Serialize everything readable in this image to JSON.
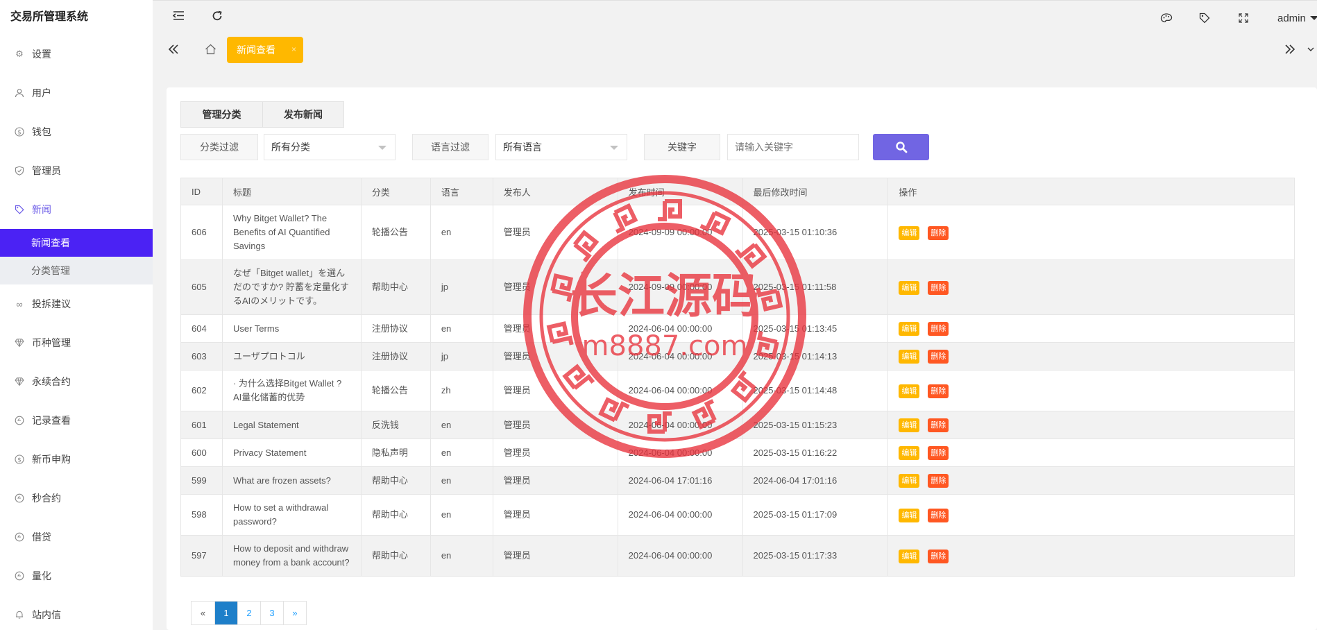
{
  "app": {
    "title": "交易所管理系统"
  },
  "header": {
    "user": "admin"
  },
  "sidebar": {
    "items": [
      {
        "label": "设置",
        "icon": "gear-icon"
      },
      {
        "label": "用户",
        "icon": "user-icon"
      },
      {
        "label": "钱包",
        "icon": "dollar-icon"
      },
      {
        "label": "管理员",
        "icon": "shield-icon"
      },
      {
        "label": "新闻",
        "icon": "tag-icon",
        "active": true
      }
    ],
    "sub_items": [
      {
        "label": "新闻查看",
        "active": true
      },
      {
        "label": "分类管理"
      }
    ],
    "items_after": [
      {
        "label": "投拆建议",
        "icon": "link-icon"
      },
      {
        "label": "币种管理",
        "icon": "diamond-icon"
      },
      {
        "label": "永续合约",
        "icon": "diamond-icon"
      },
      {
        "label": "记录查看",
        "icon": "circle-icon"
      },
      {
        "label": "新币申购",
        "icon": "dollar-icon"
      },
      {
        "label": "秒合约",
        "icon": "circle-icon"
      },
      {
        "label": "借贷",
        "icon": "circle-icon"
      },
      {
        "label": "量化",
        "icon": "circle-icon"
      },
      {
        "label": "站内信",
        "icon": "bell-icon"
      }
    ]
  },
  "tabs": {
    "active_tab": "新闻查看",
    "close_glyph": "×"
  },
  "toolbar": {
    "manage_category": "管理分类",
    "publish_news": "发布新闻"
  },
  "filters": {
    "category_label": "分类过滤",
    "category_value": "所有分类",
    "language_label": "语言过滤",
    "language_value": "所有语言",
    "keyword_label": "关键字",
    "keyword_placeholder": "请输入关键字"
  },
  "table": {
    "columns": [
      "ID",
      "标题",
      "分类",
      "语言",
      "发布人",
      "发布时间",
      "最后修改时间",
      "操作"
    ],
    "edit_label": "编辑",
    "delete_label": "删除",
    "rows": [
      {
        "id": "606",
        "title": "Why Bitget Wallet? The Benefits of AI Quantified Savings",
        "category": "轮播公告",
        "lang": "en",
        "author": "管理员",
        "published": "2024-09-09 00:00:00",
        "modified": "2025-03-15 01:10:36"
      },
      {
        "id": "605",
        "title": "なぜ「Bitget wallet」を選んだのですか? 貯蓄を定量化するAIのメリットです。",
        "category": "帮助中心",
        "lang": "jp",
        "author": "管理员",
        "published": "2024-09-09 00:00:00",
        "modified": "2025-03-15 01:11:58"
      },
      {
        "id": "604",
        "title": "User Terms",
        "category": "注册协议",
        "lang": "en",
        "author": "管理员",
        "published": "2024-06-04 00:00:00",
        "modified": "2025-03-15 01:13:45"
      },
      {
        "id": "603",
        "title": "ユーザプロトコル",
        "category": "注册协议",
        "lang": "jp",
        "author": "管理员",
        "published": "2024-06-04 00:00:00",
        "modified": "2025-03-15 01:14:13"
      },
      {
        "id": "602",
        "title": "· 为什么选择Bitget Wallet ? AI量化储蓄的优势",
        "category": "轮播公告",
        "lang": "zh",
        "author": "管理员",
        "published": "2024-06-04 00:00:00",
        "modified": "2025-03-15 01:14:48"
      },
      {
        "id": "601",
        "title": "Legal Statement",
        "category": "反洗钱",
        "lang": "en",
        "author": "管理员",
        "published": "2024-06-04 00:00:00",
        "modified": "2025-03-15 01:15:23"
      },
      {
        "id": "600",
        "title": "Privacy Statement",
        "category": "隐私声明",
        "lang": "en",
        "author": "管理员",
        "published": "2024-06-04 00:00:00",
        "modified": "2025-03-15 01:16:22"
      },
      {
        "id": "599",
        "title": "What are frozen assets?",
        "category": "帮助中心",
        "lang": "en",
        "author": "管理员",
        "published": "2024-06-04 17:01:16",
        "modified": "2024-06-04 17:01:16"
      },
      {
        "id": "598",
        "title": "How to set a withdrawal password?",
        "category": "帮助中心",
        "lang": "en",
        "author": "管理员",
        "published": "2024-06-04 00:00:00",
        "modified": "2025-03-15 01:17:09"
      },
      {
        "id": "597",
        "title": "How to deposit and withdraw money from a bank account?",
        "category": "帮助中心",
        "lang": "en",
        "author": "管理员",
        "published": "2024-06-04 00:00:00",
        "modified": "2025-03-15 01:17:33"
      }
    ]
  },
  "pagination": {
    "prev": "«",
    "pages": [
      "1",
      "2",
      "3"
    ],
    "current": "1",
    "next": "»"
  },
  "watermark": {
    "title": "长江源码",
    "url": "m8887.com",
    "color": "#e8323c"
  }
}
